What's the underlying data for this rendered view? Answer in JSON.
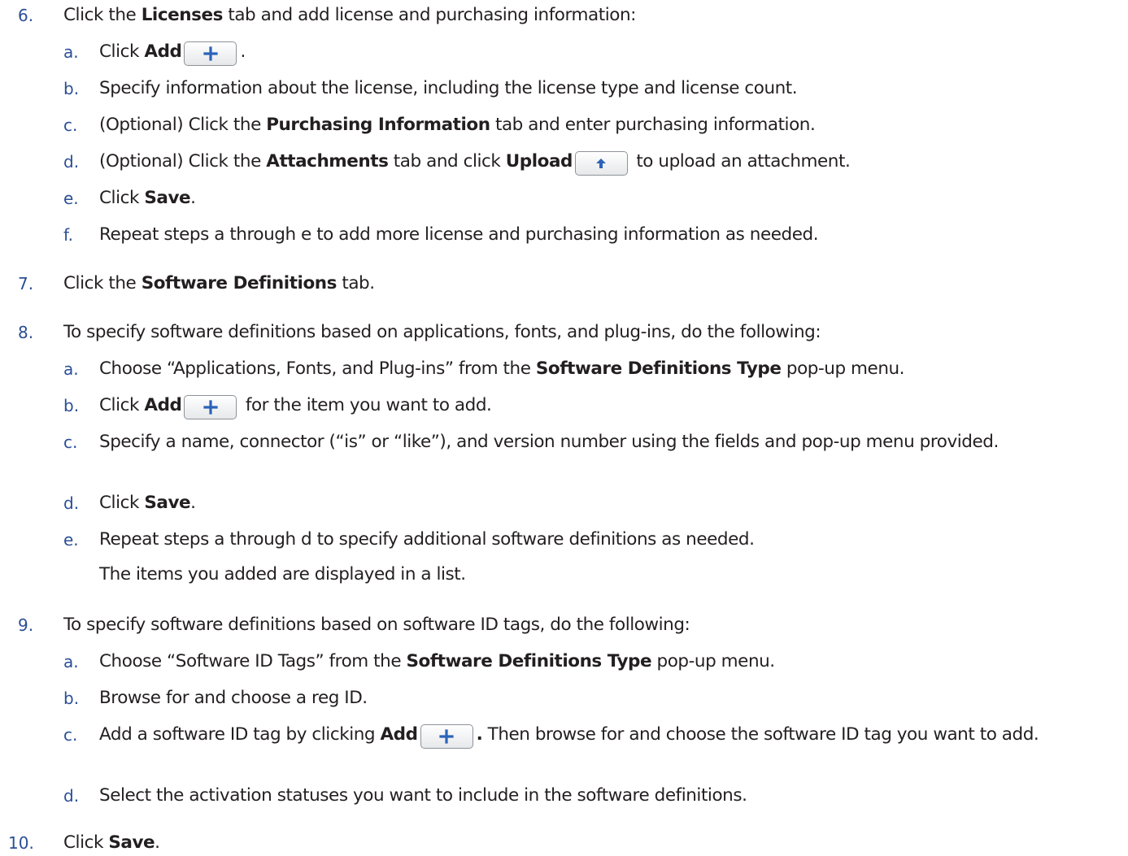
{
  "steps": [
    {
      "num": "6.",
      "parts": [
        "Click the ",
        "Licenses",
        " tab and add license and purchasing information:"
      ],
      "substeps": [
        {
          "letter": "a.",
          "text1": "Click ",
          "bold1": "Add",
          "text2": "."
        },
        {
          "letter": "b.",
          "text": "Specify information about the license, including the license type and license count."
        },
        {
          "letter": "c.",
          "text1": "(Optional) Click the ",
          "bold1": "Purchasing Information",
          "text2": " tab and enter purchasing information."
        },
        {
          "letter": "d.",
          "text1": "(Optional) Click the ",
          "bold1": "Attachments",
          "text2": " tab and click ",
          "bold2": "Upload",
          "text3": " to upload an attachment."
        },
        {
          "letter": "e.",
          "text1": "Click ",
          "bold1": "Save",
          "text2": "."
        },
        {
          "letter": "f.",
          "text": "Repeat steps a through e to add more license and purchasing information as needed."
        }
      ]
    },
    {
      "num": "7.",
      "parts": [
        "Click the ",
        "Software Definitions",
        " tab."
      ]
    },
    {
      "num": "8.",
      "text": "To specify software definitions based on applications, fonts, and plug-ins, do the following:",
      "substeps": [
        {
          "letter": "a.",
          "text1": "Choose “Applications, Fonts, and Plug-ins” from the ",
          "bold1": "Software Definitions Type",
          "text2": " pop-up menu."
        },
        {
          "letter": "b.",
          "text1": "Click ",
          "bold1": "Add",
          "text2": " for the item you want to add."
        },
        {
          "letter": "c.",
          "text": "Specify a name, connector (“is” or “like”), and version number using the fields and pop-up menu provided."
        },
        {
          "letter": "d.",
          "text1": "Click ",
          "bold1": "Save",
          "text2": "."
        },
        {
          "letter": "e.",
          "text": "Repeat steps a through d to specify additional software definitions as needed."
        }
      ],
      "note": "The items you added are displayed in a list."
    },
    {
      "num": "9.",
      "text": "To specify software definitions based on software ID tags, do the following:",
      "substeps": [
        {
          "letter": "a.",
          "text1": "Choose “Software ID Tags” from the ",
          "bold1": "Software Definitions Type",
          "text2": " pop-up menu."
        },
        {
          "letter": "b.",
          "text": "Browse for and choose a reg ID."
        },
        {
          "letter": "c.",
          "text1": "Add a software ID tag by clicking ",
          "bold1": "Add",
          "text2": ".",
          "text3": " Then browse for and choose the software ID tag you want to add."
        },
        {
          "letter": "d.",
          "text": "Select the activation statuses you want to include in the software definitions."
        }
      ]
    },
    {
      "num": "10.",
      "parts": [
        "Click ",
        "Save",
        "."
      ]
    }
  ],
  "icons": {
    "add": "plus-icon",
    "upload": "up-arrow-icon"
  },
  "colors": {
    "number": "#2b4f96",
    "text": "#231f20",
    "icon": "#2b63b8"
  }
}
